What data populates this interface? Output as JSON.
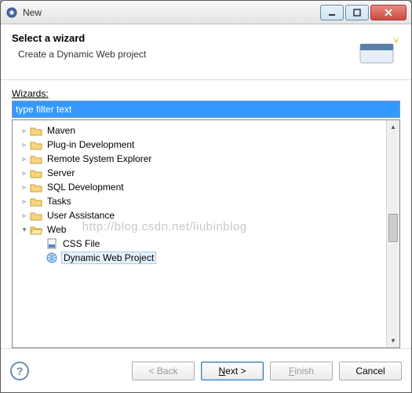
{
  "window": {
    "title": "New"
  },
  "header": {
    "title": "Select a wizard",
    "description": "Create a Dynamic Web project"
  },
  "wizards": {
    "label_pre": "W",
    "label_rest": "izards:",
    "filter_placeholder": "type filter text"
  },
  "tree": {
    "items": [
      {
        "label": "Maven",
        "expanded": false,
        "depth": 0,
        "icon": "folder"
      },
      {
        "label": "Plug-in Development",
        "expanded": false,
        "depth": 0,
        "icon": "folder"
      },
      {
        "label": "Remote System Explorer",
        "expanded": false,
        "depth": 0,
        "icon": "folder"
      },
      {
        "label": "Server",
        "expanded": false,
        "depth": 0,
        "icon": "folder"
      },
      {
        "label": "SQL Development",
        "expanded": false,
        "depth": 0,
        "icon": "folder"
      },
      {
        "label": "Tasks",
        "expanded": false,
        "depth": 0,
        "icon": "folder"
      },
      {
        "label": "User Assistance",
        "expanded": false,
        "depth": 0,
        "icon": "folder"
      },
      {
        "label": "Web",
        "expanded": true,
        "depth": 0,
        "icon": "folder-open"
      },
      {
        "label": "CSS File",
        "expanded": null,
        "depth": 1,
        "icon": "css-file"
      },
      {
        "label": "Dynamic Web Project",
        "expanded": null,
        "depth": 1,
        "icon": "web-project",
        "selected": true
      }
    ]
  },
  "watermark": "http://blog.csdn.net/liubinblog",
  "buttons": {
    "back": "< Back",
    "next_pre": "N",
    "next_rest": "ext >",
    "finish_pre": "F",
    "finish_rest": "inish",
    "cancel": "Cancel"
  }
}
